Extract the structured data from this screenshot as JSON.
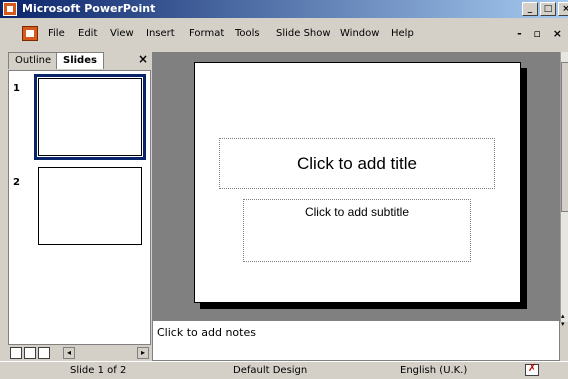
{
  "window": {
    "title": "Microsoft PowerPoint"
  },
  "menus": [
    "File",
    "Edit",
    "View",
    "Insert",
    "Format",
    "Tools",
    "Slide Show",
    "Window",
    "Help"
  ],
  "panel_tabs": {
    "outline": "Outline",
    "slides": "Slides",
    "close": "×"
  },
  "thumbnails": [
    {
      "number": "1"
    },
    {
      "number": "2"
    }
  ],
  "slide": {
    "title_placeholder": "Click to add title",
    "subtitle_placeholder": "Click to add subtitle"
  },
  "notes": {
    "placeholder": "Click to add notes"
  },
  "status": {
    "slide": "Slide 1 of 2",
    "design": "Default Design",
    "language": "English (U.K.)"
  },
  "icons": [
    "powerpoint-icon",
    "minimize-icon",
    "restore-icon",
    "close-icon",
    "normal-view-icon",
    "slide-sorter-icon",
    "slide-show-icon",
    "spelling-icon"
  ]
}
